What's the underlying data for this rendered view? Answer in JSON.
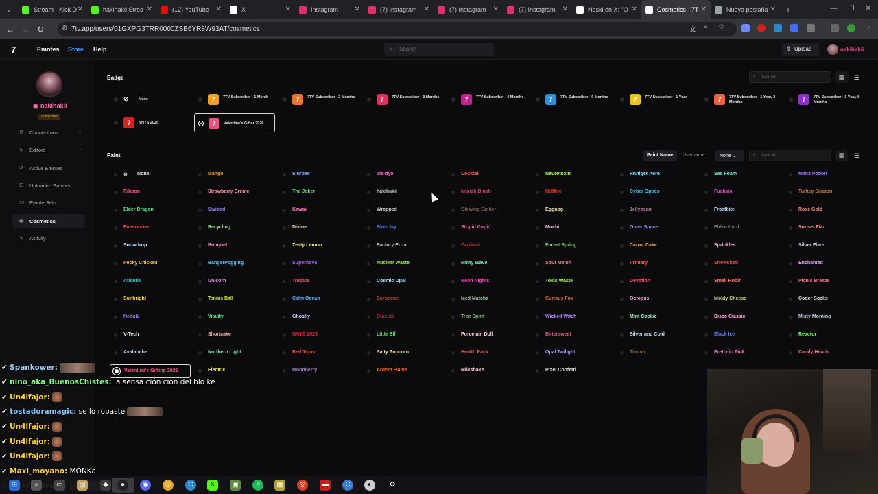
{
  "browser": {
    "tabs": [
      {
        "label": "Stream - Kick D",
        "color": "#53fc18",
        "active": false
      },
      {
        "label": "hakihakii Strea",
        "color": "#53fc18",
        "active": false
      },
      {
        "label": "(12) YouTube",
        "color": "#ff0000",
        "active": false
      },
      {
        "label": "X",
        "color": "#ffffff",
        "active": false
      },
      {
        "label": "Instagram",
        "color": "#e1306c",
        "active": false
      },
      {
        "label": "(7) Instagram",
        "color": "#e1306c",
        "active": false
      },
      {
        "label": "(7) Instagram",
        "color": "#e1306c",
        "active": false
      },
      {
        "label": "(7) Instagram",
        "color": "#e1306c",
        "active": false
      },
      {
        "label": "Noski en X: \"O",
        "color": "#ffffff",
        "active": false
      },
      {
        "label": "Cosmetics - 7T",
        "color": "#ffffff",
        "active": true
      },
      {
        "label": "Nueva pestaña",
        "color": "#9aa0a6",
        "active": false
      }
    ],
    "url": "7tv.app/users/01GXPG3TRR0000ZSB6YR8W93AT/cosmetics"
  },
  "header": {
    "logo": "7",
    "nav": [
      "Emotes",
      "Store",
      "Help"
    ],
    "search_placeholder": "Search",
    "upload_label": "Upload",
    "username": "nakihakii"
  },
  "sidebar": {
    "username": "nakihakii",
    "role": "Subscriber",
    "items": [
      {
        "label": "Connections",
        "icon": "link-icon",
        "chevron": true
      },
      {
        "label": "Editors",
        "icon": "edit-icon",
        "chevron": true
      },
      {
        "label": "Active Emotes",
        "icon": "smile-icon",
        "chevron": false
      },
      {
        "label": "Uploaded Emotes",
        "icon": "upload-icon",
        "chevron": false
      },
      {
        "label": "Emote Sets",
        "icon": "folder-icon",
        "chevron": false
      },
      {
        "label": "Cosmetics",
        "icon": "paint-icon",
        "chevron": false,
        "active": true
      },
      {
        "label": "Activity",
        "icon": "activity-icon",
        "chevron": false
      }
    ]
  },
  "badges": {
    "title": "Badge",
    "search_placeholder": "Search",
    "items": [
      {
        "label": "None",
        "color": null
      },
      {
        "label": "7TV Subscriber - 1 Month",
        "color": "#f0a020"
      },
      {
        "label": "7TV Subscriber - 2 Months",
        "color": "#f07030"
      },
      {
        "label": "7TV Subscriber - 3 Months",
        "color": "#e03060"
      },
      {
        "label": "7TV Subscriber - 6 Months",
        "color": "#c02090"
      },
      {
        "label": "7TV Subscriber - 9 Months",
        "color": "#2a90e0"
      },
      {
        "label": "7TV Subscriber - 1 Year",
        "color": "#f0c020"
      },
      {
        "label": "7TV Subscriber - 1 Year, 3 Months",
        "color": "#f06040"
      },
      {
        "label": "7TV Subscriber - 1 Year, 6 Months",
        "color": "#9030d0"
      },
      {
        "label": "NNYS 2025",
        "color": "#e02020"
      },
      {
        "label": "Valentine's Gifter 2026",
        "color": "#f05080",
        "selected": true
      }
    ]
  },
  "paints": {
    "title": "Paint",
    "tabs": [
      "Paint Name",
      "Username"
    ],
    "filter": "None",
    "search_placeholder": "Search",
    "items": [
      {
        "label": "None",
        "color": "#e0e0e0"
      },
      {
        "label": "Mango",
        "color": "#f0a030"
      },
      {
        "label": "Slurpee",
        "color": "#8ab4ff"
      },
      {
        "label": "Tie-dye",
        "color": "#ff70d0"
      },
      {
        "label": "Cocktail",
        "color": "#ff6a6a"
      },
      {
        "label": "Neurotoxin",
        "color": "#b0ff60"
      },
      {
        "label": "Frutiger Aero",
        "color": "#80e0ff"
      },
      {
        "label": "Sea Foam",
        "color": "#70f0d0"
      },
      {
        "label": "Mana Potion",
        "color": "#a070ff"
      },
      {
        "label": "Ribbon",
        "color": "#ff5070"
      },
      {
        "label": "Strawberry Crème",
        "color": "#ff90a0"
      },
      {
        "label": "The Joker",
        "color": "#60d060"
      },
      {
        "label": "hakihakii",
        "color": "#c8c8c8"
      },
      {
        "label": "Impish Blush",
        "color": "#d04070"
      },
      {
        "label": "Hellfire",
        "color": "#ff4020"
      },
      {
        "label": "Cyber Optics",
        "color": "#40c0ff"
      },
      {
        "label": "Fuchsia",
        "color": "#e040c0"
      },
      {
        "label": "Turkey Season",
        "color": "#d08040"
      },
      {
        "label": "Elder Dragon",
        "color": "#60e080"
      },
      {
        "label": "Divided",
        "color": "#a080ff"
      },
      {
        "label": "Kawaii",
        "color": "#ff80c0"
      },
      {
        "label": "Wrapped",
        "color": "#d0d0d0"
      },
      {
        "label": "Glowing Ember",
        "color": "#806050"
      },
      {
        "label": "Eggnog",
        "color": "#f0e0b0"
      },
      {
        "label": "Jellybean",
        "color": "#b080a0"
      },
      {
        "label": "Frostbite",
        "color": "#c0e0ff"
      },
      {
        "label": "Rose Gold",
        "color": "#f09080"
      },
      {
        "label": "Firecracker",
        "color": "#ff5040"
      },
      {
        "label": "Recycling",
        "color": "#80e080"
      },
      {
        "label": "Divine",
        "color": "#f0e0a0"
      },
      {
        "label": "Blue Jay",
        "color": "#4080ff"
      },
      {
        "label": "Stupid Cupid",
        "color": "#ff60a0"
      },
      {
        "label": "Mochi",
        "color": "#ffb0d0"
      },
      {
        "label": "Outer Space",
        "color": "#90a0ff"
      },
      {
        "label": "Elden Lord",
        "color": "#808070"
      },
      {
        "label": "Sunset Fizz",
        "color": "#ff9080"
      },
      {
        "label": "Snowdrop",
        "color": "#d0e8ff"
      },
      {
        "label": "Bouquet",
        "color": "#ff90c0"
      },
      {
        "label": "Zesty Lemon",
        "color": "#f0f060"
      },
      {
        "label": "Factory Error",
        "color": "#c0c0c0"
      },
      {
        "label": "Cardinal",
        "color": "#d03040"
      },
      {
        "label": "Forest Spring",
        "color": "#80d080"
      },
      {
        "label": "Carrot Cake",
        "color": "#f0a060"
      },
      {
        "label": "Sprinkles",
        "color": "#ffb0e0"
      },
      {
        "label": "Silver Flare",
        "color": "#d0d0e0"
      },
      {
        "label": "Pecky Chicken",
        "color": "#f0c040"
      },
      {
        "label": "BangerPogging",
        "color": "#60c0ff"
      },
      {
        "label": "Supernova",
        "color": "#b060ff"
      },
      {
        "label": "Nuclear Waste",
        "color": "#90f040"
      },
      {
        "label": "Minty Wave",
        "color": "#70f0c0"
      },
      {
        "label": "Sour Melon",
        "color": "#ff8090"
      },
      {
        "label": "Primary",
        "color": "#ff6040"
      },
      {
        "label": "Snowshed",
        "color": "#e05040"
      },
      {
        "label": "Enchanted",
        "color": "#e0a0ff"
      },
      {
        "label": "Atlantis",
        "color": "#40c0d0"
      },
      {
        "label": "Unicorn",
        "color": "#ff90f0"
      },
      {
        "label": "Tropica",
        "color": "#ff6080"
      },
      {
        "label": "Cosmic Opal",
        "color": "#a0e0ff"
      },
      {
        "label": "Neon Nights",
        "color": "#ff40d0"
      },
      {
        "label": "Toxic Waste",
        "color": "#a0ff60"
      },
      {
        "label": "Devotion",
        "color": "#ff5070"
      },
      {
        "label": "Small Robin",
        "color": "#ff8060"
      },
      {
        "label": "Picnic Breeze",
        "color": "#ff7090"
      },
      {
        "label": "Sunbright",
        "color": "#ffd040"
      },
      {
        "label": "Tennis Ball",
        "color": "#d0f040"
      },
      {
        "label": "Calm Ocean",
        "color": "#60b0ff"
      },
      {
        "label": "Barbecue",
        "color": "#a05030"
      },
      {
        "label": "Iced Matcha",
        "color": "#a0c0a0"
      },
      {
        "label": "Curious Fox",
        "color": "#d07040"
      },
      {
        "label": "Octopus",
        "color": "#e0a0c0"
      },
      {
        "label": "Moldy Cheese",
        "color": "#c0d080"
      },
      {
        "label": "Coder Socks",
        "color": "#e0e0e0"
      },
      {
        "label": "Nebula",
        "color": "#a070ff"
      },
      {
        "label": "Vitality",
        "color": "#60f080"
      },
      {
        "label": "Ghostly",
        "color": "#c0d0ff"
      },
      {
        "label": "Dracula",
        "color": "#c02030"
      },
      {
        "label": "Tree Spirit",
        "color": "#80c080"
      },
      {
        "label": "Wicked Witch",
        "color": "#c080ff"
      },
      {
        "label": "Mint Cookie",
        "color": "#a0f0c0"
      },
      {
        "label": "Disco Classic",
        "color": "#ffa0e0"
      },
      {
        "label": "Misty Morning",
        "color": "#c0d0e0"
      },
      {
        "label": "V-Tech",
        "color": "#e0e0e0"
      },
      {
        "label": "Shortcake",
        "color": "#ffb0b0"
      },
      {
        "label": "NNYS 2025",
        "color": "#e03030"
      },
      {
        "label": "Little Elf",
        "color": "#60e060"
      },
      {
        "label": "Porcelain Doll",
        "color": "#ffd0e0"
      },
      {
        "label": "Bittersweet",
        "color": "#d06080"
      },
      {
        "label": "Silver and Cold",
        "color": "#d0e0f0"
      },
      {
        "label": "Black Ice",
        "color": "#6080ff"
      },
      {
        "label": "Reactor",
        "color": "#60ff60"
      },
      {
        "label": "Avalanche",
        "color": "#c0d0e0"
      },
      {
        "label": "Northern Light",
        "color": "#60f0c0"
      },
      {
        "label": "Red Tupac",
        "color": "#ff4040"
      },
      {
        "label": "Salty Popcorn",
        "color": "#f0e0a0"
      },
      {
        "label": "Health Pack",
        "color": "#ff5060"
      },
      {
        "label": "Opal Twilight",
        "color": "#a0a0ff"
      },
      {
        "label": "Timber",
        "color": "#806040"
      },
      {
        "label": "Pretty in Pink",
        "color": "#ff80c0"
      },
      {
        "label": "Candy Hearts",
        "color": "#ff7090"
      },
      {
        "label": "Valentine's Gifting 2026",
        "color": "#ff5080",
        "selected": true
      },
      {
        "label": "Electric",
        "color": "#f0f040"
      },
      {
        "label": "Moonberry",
        "color": "#a080c0"
      },
      {
        "label": "Ardent Flame",
        "color": "#ff6030"
      },
      {
        "label": "Milkshake",
        "color": "#ffd0e0"
      },
      {
        "label": "Pixel Confetti",
        "color": "#e0e0e0"
      }
    ]
  },
  "chat": [
    {
      "name": "Spankower:",
      "name_color": "#a0d0ff",
      "text": "",
      "emote": "wide"
    },
    {
      "name": "nino_aka_BuenosChistes:",
      "name_color": "#80ff80",
      "text": " la sensa ción cion del blo ke",
      "emote": ""
    },
    {
      "name": "Un4lfajor:",
      "name_color": "#ffd040",
      "text": "",
      "emote": "small"
    },
    {
      "name": "tostadoramagic:",
      "name_color": "#80c0ff",
      "text": " se lo robaste",
      "emote": "wide"
    },
    {
      "name": "Un4lfajor:",
      "name_color": "#ffd040",
      "text": "",
      "emote": "small"
    },
    {
      "name": "Un4lfajor:",
      "name_color": "#ffd040",
      "text": "",
      "emote": "small"
    },
    {
      "name": "Un4lfajor:",
      "name_color": "#ffd040",
      "text": "",
      "emote": "small"
    },
    {
      "name": "Maxi_moyano:",
      "name_color": "#ffd040",
      "text": " MONKa",
      "emote": ""
    },
    {
      "name": "Maxi_moyano:",
      "name_color": "#ffd040",
      "text": "",
      "emote": "wide"
    }
  ]
}
